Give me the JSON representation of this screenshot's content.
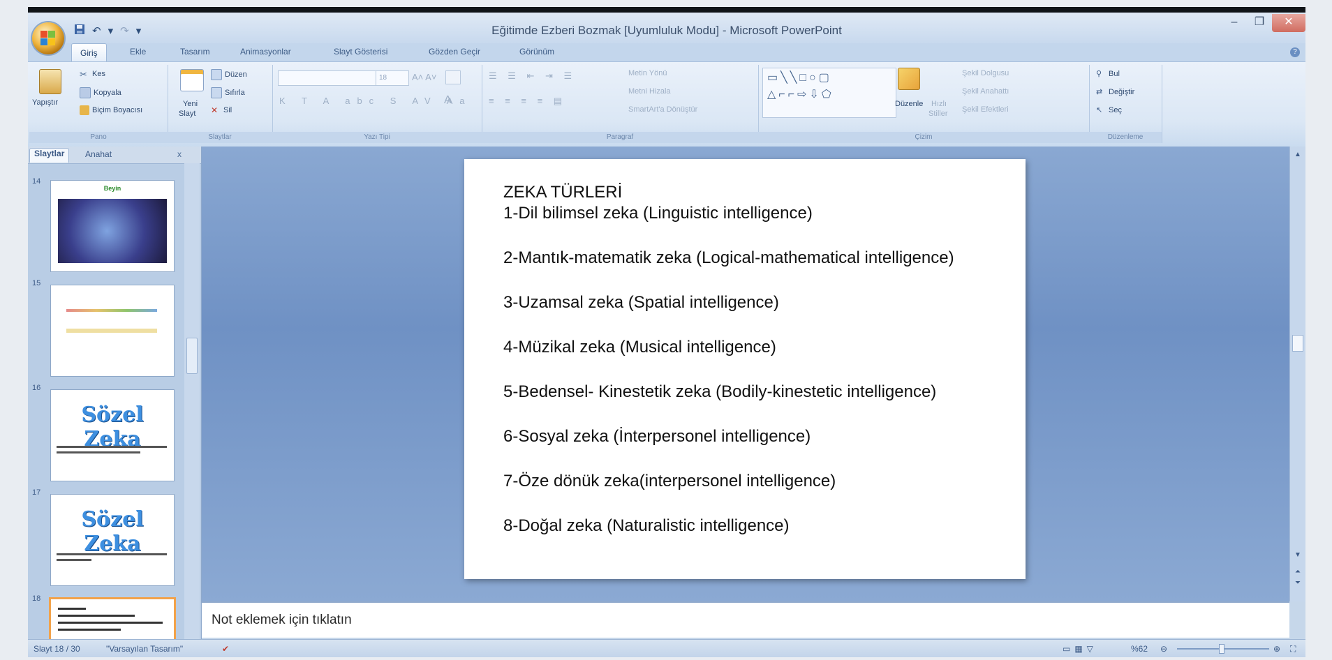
{
  "window": {
    "title": "Eğitimde Ezberi Bozmak [Uyumluluk Modu] - Microsoft PowerPoint",
    "minimize_glyph": "–",
    "restore_glyph": "❐",
    "close_glyph": "✕"
  },
  "quick_access": {
    "save_icon": "save-icon",
    "undo_icon": "undo-icon",
    "redo_icon": "redo-icon"
  },
  "tabs": [
    "Giriş",
    "Ekle",
    "Tasarım",
    "Animasyonlar",
    "Slayt Gösterisi",
    "Gözden Geçir",
    "Görünüm"
  ],
  "ribbon": {
    "clipboard": {
      "paste": "Yapıştır",
      "cut": "Kes",
      "copy": "Kopyala",
      "format_painter": "Biçim Boyacısı",
      "label": "Pano"
    },
    "slides": {
      "new_slide_1": "Yeni",
      "new_slide_2": "Slayt",
      "layout": "Düzen",
      "reset": "Sıfırla",
      "delete": "Sil",
      "label": "Slaytlar"
    },
    "font": {
      "size": "18",
      "label": "Yazı Tipi"
    },
    "paragraph": {
      "text_direction": "Metin Yönü",
      "align_text": "Metni Hizala",
      "smartart": "SmartArt'a Dönüştür",
      "label": "Paragraf"
    },
    "drawing": {
      "arrange": "Düzenle",
      "quick_styles_1": "Hızlı",
      "quick_styles_2": "Stiller",
      "fill": "Şekil Dolgusu",
      "outline": "Şekil Anahattı",
      "effects": "Şekil Efektleri",
      "label": "Çizim"
    },
    "editing": {
      "find": "Bul",
      "replace": "Değiştir",
      "select": "Seç",
      "label": "Düzenleme"
    }
  },
  "left_panel": {
    "tab_slides": "Slaytlar",
    "tab_outline": "Anahat",
    "close": "x",
    "thumbnails": [
      {
        "num": "14",
        "title": "Beyin"
      },
      {
        "num": "15",
        "title": ""
      },
      {
        "num": "16",
        "title": "Sözel Zeka"
      },
      {
        "num": "17",
        "title": "Sözel Zeka"
      },
      {
        "num": "18",
        "title": ""
      }
    ]
  },
  "slide": {
    "title": "ZEKA TÜRLERİ",
    "items": [
      "1-Dil bilimsel zeka (Linguistic intelligence)",
      "2-Mantık-matematik zeka (Logical-mathematical intelligence)",
      "3-Uzamsal zeka (Spatial intelligence)",
      "4-Müzikal zeka (Musical intelligence)",
      "5-Bedensel- Kinestetik zeka (Bodily-kinestetic intelligence)",
      "6-Sosyal zeka (İnterpersonel intelligence)",
      "7-Öze dönük zeka(interpersonel intelligence)",
      "8-Doğal zeka (Naturalistic intelligence)"
    ]
  },
  "notes": {
    "placeholder": "Not eklemek için tıklatın"
  },
  "status": {
    "slide": "Slayt 18 / 30",
    "theme": "\"Varsayılan Tasarım\"",
    "zoom": "%62"
  },
  "colors": {
    "main_bg": "#7594c6",
    "accent_orange": "#f2a24a",
    "ribbon_bg": "#dbe7f5"
  }
}
